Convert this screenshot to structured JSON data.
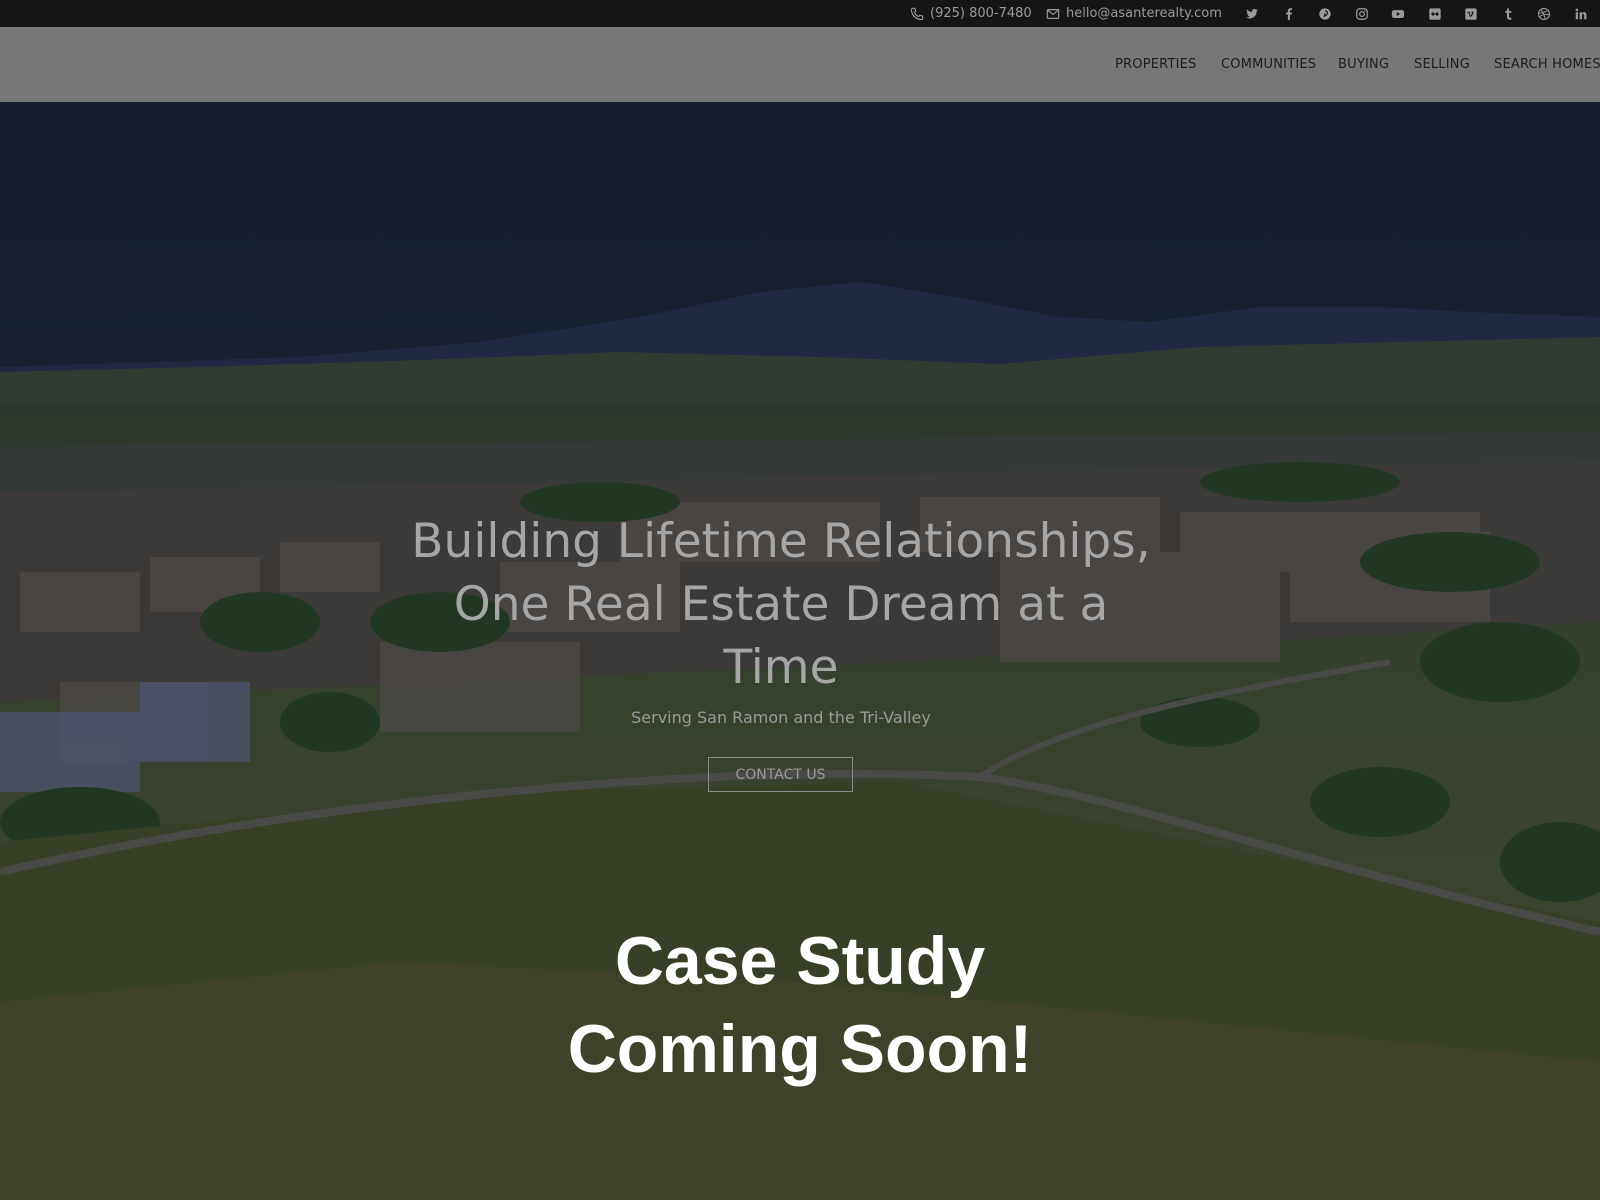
{
  "topbar": {
    "phone": "(925) 800-7480",
    "email": "hello@asanterealty.com",
    "socials": [
      "twitter-icon",
      "facebook-icon",
      "pinterest-icon",
      "instagram-icon",
      "youtube-icon",
      "flickr-icon",
      "vimeo-icon",
      "tumblr-icon",
      "dribbble-icon",
      "linkedin-icon"
    ]
  },
  "nav": {
    "items": [
      "PROPERTIES",
      "COMMUNITIES",
      "BUYING",
      "SELLING",
      "SEARCH HOMES"
    ]
  },
  "hero": {
    "headline": "Building Lifetime Relationships, One Real Estate Dream at a Time",
    "subheadline": "Serving San Ramon and the Tri-Valley",
    "cta": "CONTACT US"
  },
  "overlay": {
    "line1": "Case Study",
    "line2": "Coming Soon!"
  },
  "colors": {
    "topbar_bg": "#161616",
    "nav_bg": "#777777",
    "overlay_text": "#ffffff"
  }
}
